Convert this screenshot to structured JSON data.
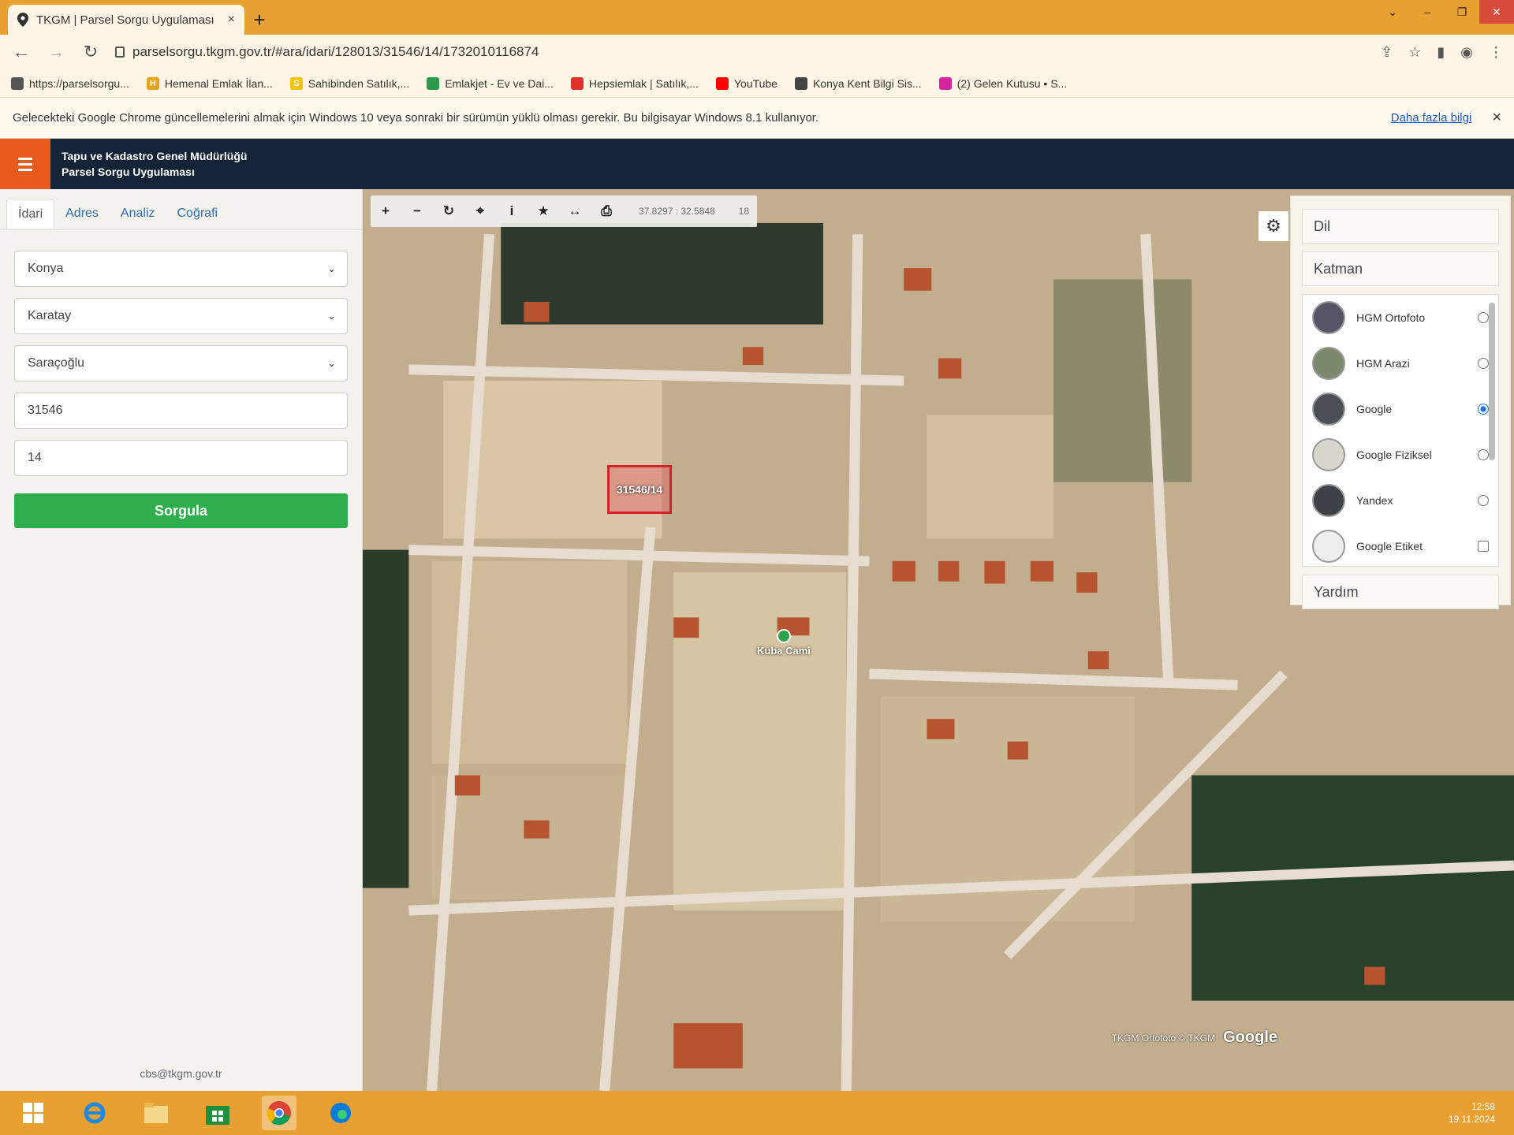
{
  "browser": {
    "tab_title": "TKGM | Parsel Sorgu Uygulaması",
    "tab_close": "×",
    "new_tab": "+",
    "url": "parselsorgu.tkgm.gov.tr/#ara/idari/128013/31546/14/1732010116874",
    "bookmarks": [
      {
        "label": "https://parselsorgu...",
        "icon": "pin-icon",
        "color": "#555555"
      },
      {
        "label": "Hemenal Emlak İlan...",
        "icon": "H",
        "color": "#e6a317"
      },
      {
        "label": "Sahibinden Satılık,...",
        "icon": "S",
        "color": "#f5c400"
      },
      {
        "label": "Emlakjet - Ev ve Dai...",
        "icon": "house-icon",
        "color": "#2b9b4a"
      },
      {
        "label": "Hepsiemlak | Satılık,...",
        "icon": "roof-icon",
        "color": "#e0322b"
      },
      {
        "label": "YouTube",
        "icon": "youtube-icon",
        "color": "#ff0000"
      },
      {
        "label": "Konya Kent Bilgi Sis...",
        "icon": "globe-icon",
        "color": "#444444"
      },
      {
        "label": "(2) Gelen Kutusu • S...",
        "icon": "instagram-icon",
        "color": "#d6249f"
      }
    ],
    "infobar": {
      "message": "Gelecekteki Google Chrome güncellemelerini almak için Windows 10 veya sonraki bir sürümün yüklü olması gerekir. Bu bilgisayar Windows 8.1 kullanıyor.",
      "link": "Daha fazla bilgi",
      "close": "×"
    }
  },
  "app": {
    "title_line1": "Tapu ve Kadastro Genel Müdürlüğü",
    "title_line2": "Parsel Sorgu Uygulaması",
    "accent": "#e85a1c",
    "header_bg": "#142436"
  },
  "panel": {
    "tabs": [
      "İdari",
      "Adres",
      "Analiz",
      "Coğrafi"
    ],
    "active_tab": "İdari",
    "province": "Konya",
    "district": "Karatay",
    "neighborhood": "Saraçoğlu",
    "block": "31546",
    "parcel": "14",
    "query_button": "Sorgula",
    "email": "cbs@tkgm.gov.tr"
  },
  "map": {
    "coords": "37.8297 : 32.5848",
    "zoom": "18",
    "parcel_label": "31546/14",
    "poi_label": "Kuba Cami",
    "attribution": "TKGM Ortofoto © TKGM",
    "google": "Google"
  },
  "layer_panel": {
    "language": "Dil",
    "layers_title": "Katman",
    "help": "Yardım",
    "layers": [
      {
        "name": "HGM Ortofoto",
        "selected": false
      },
      {
        "name": "HGM Arazi",
        "selected": false
      },
      {
        "name": "Google",
        "selected": true
      },
      {
        "name": "Google Fiziksel",
        "selected": false
      },
      {
        "name": "Yandex",
        "selected": false
      },
      {
        "name": "Google Etiket",
        "selected": false
      }
    ]
  },
  "taskbar": {
    "time": "12:58",
    "date": "19.11.2024"
  }
}
